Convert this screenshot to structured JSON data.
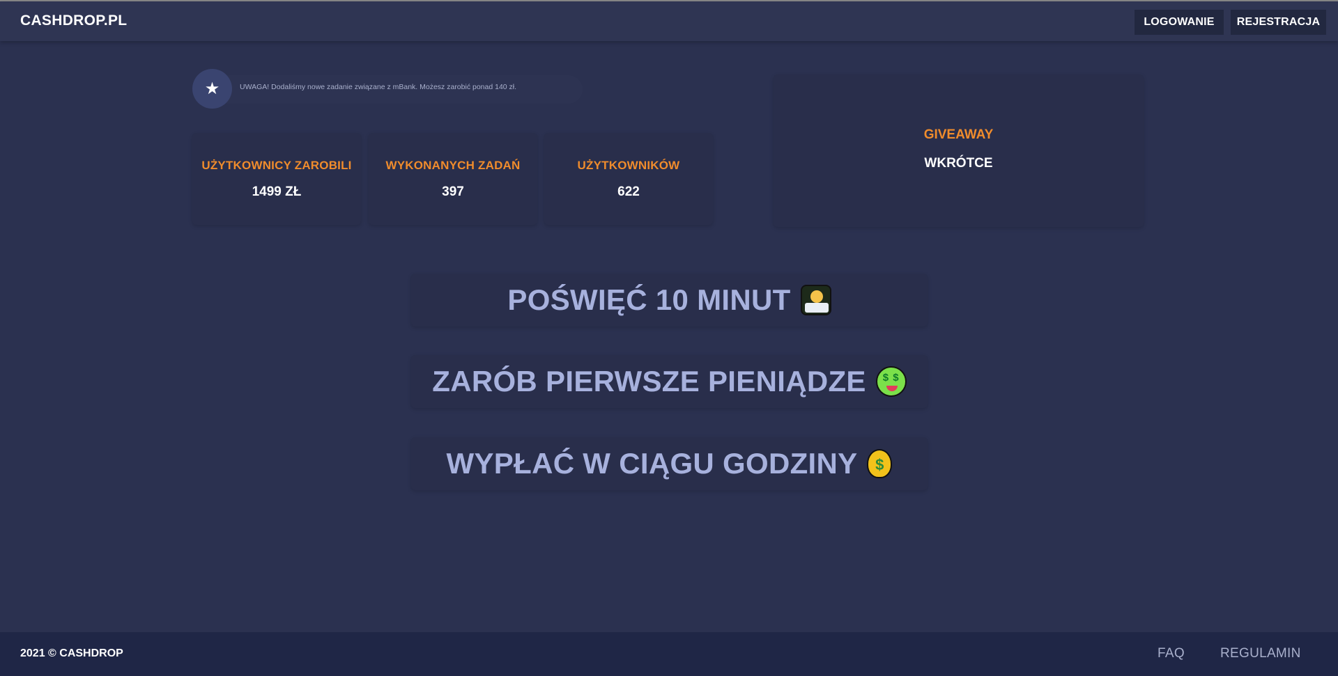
{
  "header": {
    "brand": "CASHDROP.PL",
    "login_label": "LOGOWANIE",
    "register_label": "REJESTRACJA"
  },
  "notice": {
    "icon": "star-icon",
    "text": "UWAGA! Dodaliśmy nowe zadanie związane z mBank. Możesz zarobić ponad 140 zł."
  },
  "stats": [
    {
      "label": "UŻYTKOWNICY ZAROBILI",
      "value": "1499 ZŁ"
    },
    {
      "label": "WYKONANYCH ZADAŃ",
      "value": "397"
    },
    {
      "label": "UŻYTKOWNIKÓW",
      "value": "622"
    }
  ],
  "giveaway": {
    "title": "GIVEAWAY",
    "subtitle": "WKRÓTCE"
  },
  "slogans": [
    {
      "text": "POŚWIĘĆ 10 MINUT",
      "icon": "technologist-emoji-icon"
    },
    {
      "text": "ZARÓB PIERWSZE PIENIĄDZE",
      "icon": "money-mouth-face-icon"
    },
    {
      "text": "WYPŁAĆ W CIĄGU GODZINY",
      "icon": "money-bag-icon"
    }
  ],
  "footer": {
    "copyright": "2021 © CASHDROP",
    "faq_label": "FAQ",
    "regulamin_label": "REGULAMIN"
  },
  "colors": {
    "background": "#2b3150",
    "accent_orange": "#f08c2c",
    "slogan_text": "#a7b1dd",
    "footer_bg": "#1f2646"
  }
}
